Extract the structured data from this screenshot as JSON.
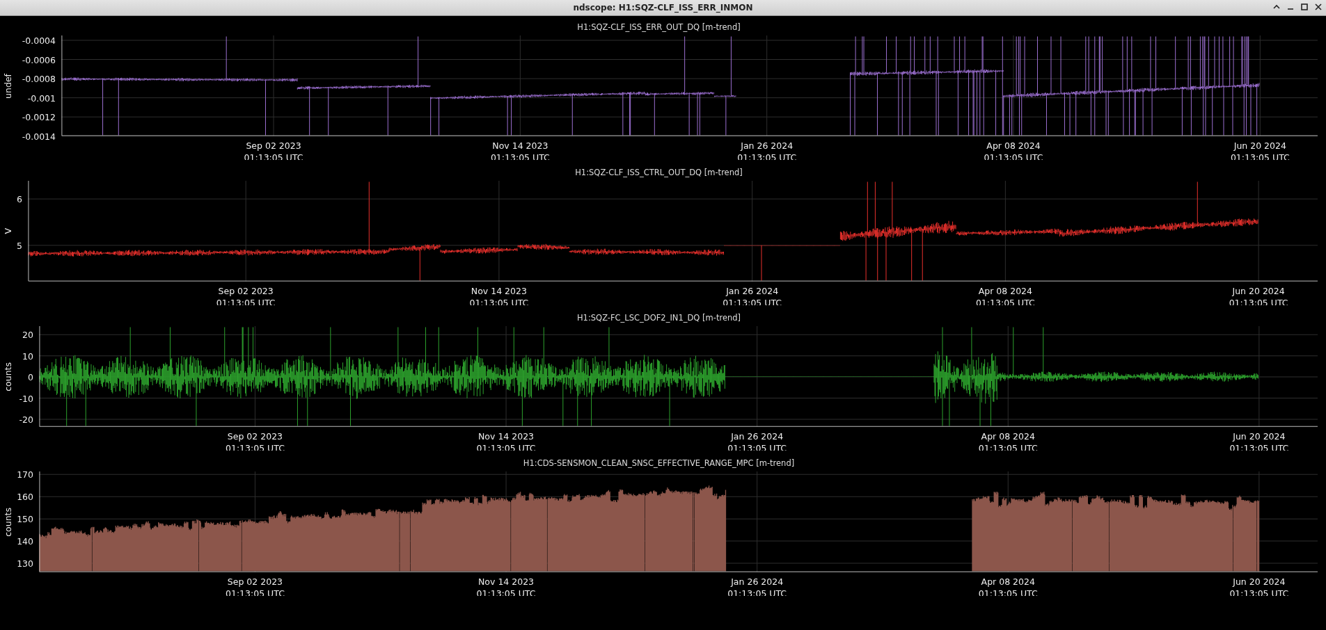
{
  "window": {
    "title": "ndscope: H1:SQZ-CLF_ISS_ERR_INMON"
  },
  "plots": [
    {
      "title": "H1:SQZ-CLF_ISS_ERR_OUT_DQ [m-trend]",
      "ylabel": "undef",
      "kind": "line",
      "color": "#9b6fd0",
      "yticks": [
        "-0.0004",
        "-0.0006",
        "-0.0008",
        "-0.001",
        "-0.0012",
        "-0.0014"
      ],
      "xticks": [
        {
          "date": "Sep 02 2023",
          "time": "01:13:05 UTC"
        },
        {
          "date": "Nov 14 2023",
          "time": "01:13:05 UTC"
        },
        {
          "date": "Jan 26 2024",
          "time": "01:13:05 UTC"
        },
        {
          "date": "Apr 08 2024",
          "time": "01:13:05 UTC"
        },
        {
          "date": "Jun 20 2024",
          "time": "01:13:05 UTC"
        }
      ]
    },
    {
      "title": "H1:SQZ-CLF_ISS_CTRL_OUT_DQ [m-trend]",
      "ylabel": "V",
      "kind": "line",
      "color": "#e8302c",
      "yticks": [
        "6",
        "5"
      ],
      "xticks": [
        {
          "date": "Sep 02 2023",
          "time": "01:13:05 UTC"
        },
        {
          "date": "Nov 14 2023",
          "time": "01:13:05 UTC"
        },
        {
          "date": "Jan 26 2024",
          "time": "01:13:05 UTC"
        },
        {
          "date": "Apr 08 2024",
          "time": "01:13:05 UTC"
        },
        {
          "date": "Jun 20 2024",
          "time": "01:13:05 UTC"
        }
      ]
    },
    {
      "title": "H1:SQZ-FC_LSC_DOF2_IN1_DQ [m-trend]",
      "ylabel": "counts",
      "kind": "line",
      "color": "#2ca02c",
      "yticks": [
        "20",
        "10",
        "0",
        "-10",
        "-20"
      ],
      "xticks": [
        {
          "date": "Sep 02 2023",
          "time": "01:13:05 UTC"
        },
        {
          "date": "Nov 14 2023",
          "time": "01:13:05 UTC"
        },
        {
          "date": "Jan 26 2024",
          "time": "01:13:05 UTC"
        },
        {
          "date": "Apr 08 2024",
          "time": "01:13:05 UTC"
        },
        {
          "date": "Jun 20 2024",
          "time": "01:13:05 UTC"
        }
      ]
    },
    {
      "title": "H1:CDS-SENSMON_CLEAN_SNSC_EFFECTIVE_RANGE_MPC [m-trend]",
      "ylabel": "counts",
      "kind": "fill",
      "color": "#8c564b",
      "yticks": [
        "170",
        "160",
        "150",
        "140",
        "130"
      ],
      "xticks": [
        {
          "date": "Sep 02 2023",
          "time": "01:13:05 UTC"
        },
        {
          "date": "Nov 14 2023",
          "time": "01:13:05 UTC"
        },
        {
          "date": "Jan 26 2024",
          "time": "01:13:05 UTC"
        },
        {
          "date": "Apr 08 2024",
          "time": "01:13:05 UTC"
        },
        {
          "date": "Jun 20 2024",
          "time": "01:13:05 UTC"
        }
      ]
    }
  ]
}
